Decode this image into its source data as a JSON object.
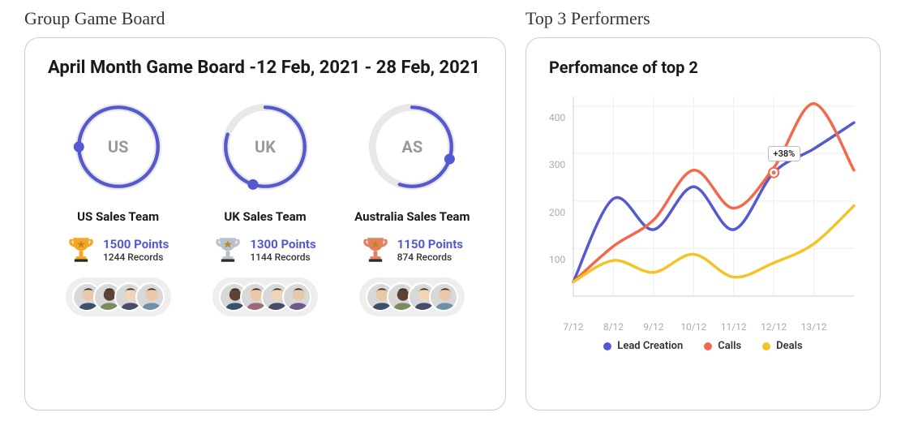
{
  "left": {
    "heading": "Group Game Board",
    "title": "April Month Game Board -12 Feb, 2021 - 28 Feb, 2021",
    "teams": [
      {
        "code": "US",
        "name": "US Sales Team",
        "points": "1500 Points",
        "records": "1244 Records",
        "progress": 100,
        "trophyColor": "#f6a623"
      },
      {
        "code": "UK",
        "name": "UK Sales Team",
        "points": "1300 Points",
        "records": "1144 Records",
        "progress": 80,
        "trophyColor": "#b8c0c9"
      },
      {
        "code": "AS",
        "name": "Australia Sales Team",
        "points": "1150 Points",
        "records": "874 Records",
        "progress": 55,
        "trophyColor": "#e2805f"
      }
    ]
  },
  "right": {
    "heading": "Top 3 Performers",
    "title": "Perfomance of top 2",
    "tooltip": "+38%",
    "legend": [
      {
        "label": "Lead Creation",
        "color": "#5459d0"
      },
      {
        "label": "Calls",
        "color": "#f26a4b"
      },
      {
        "label": "Deals",
        "color": "#f4c326"
      }
    ]
  },
  "chart_data": {
    "type": "line",
    "title": "Perfomance of top 2",
    "xlabel": "",
    "ylabel": "",
    "ylim": [
      0,
      420
    ],
    "categories": [
      "7/12",
      "8/12",
      "9/12",
      "10/12",
      "11/12",
      "12/12",
      "13/12"
    ],
    "series": [
      {
        "name": "Lead Creation",
        "color": "#5459d0",
        "values": [
          30,
          205,
          140,
          230,
          140,
          260,
          310,
          365
        ]
      },
      {
        "name": "Calls",
        "color": "#f26a4b",
        "values": [
          30,
          105,
          160,
          265,
          185,
          270,
          405,
          265
        ]
      },
      {
        "name": "Deals",
        "color": "#f4c326",
        "values": [
          30,
          75,
          50,
          88,
          40,
          70,
          110,
          190
        ]
      }
    ],
    "annotation": {
      "text": "+38%",
      "x_index": 5,
      "y": 260
    }
  },
  "avatarColors": [
    [
      "#e9c7a8",
      "#3a506b"
    ],
    [
      "#5a4235",
      "#7a8b5c"
    ],
    [
      "#f1d5b9",
      "#4a4a6a"
    ],
    [
      "#e9c7a8",
      "#6e8fa8"
    ],
    [
      "#5a4235",
      "#3a506b"
    ],
    [
      "#e9c7a8",
      "#9a6a7a"
    ],
    [
      "#f1d5b9",
      "#4a4a6a"
    ],
    [
      "#e9c7a8",
      "#6e5a8a"
    ],
    [
      "#e9c7a8",
      "#3a506b"
    ],
    [
      "#5a4235",
      "#7a8b5c"
    ],
    [
      "#f1d5b9",
      "#4a4a6a"
    ],
    [
      "#e9c7a8",
      "#6e8fa8"
    ]
  ]
}
